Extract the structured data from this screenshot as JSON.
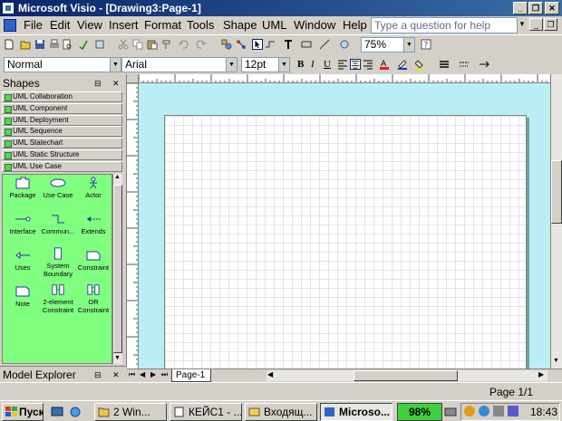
{
  "titlebar": {
    "title": "Microsoft Visio - [Drawing3:Page-1]",
    "minimize": "_",
    "restore": "❐",
    "close": "✕"
  },
  "menubar": {
    "items": [
      "File",
      "Edit",
      "View",
      "Insert",
      "Format",
      "Tools",
      "Shape",
      "UML",
      "Window",
      "Help"
    ],
    "ask_placeholder": "Type a question for help",
    "doc_min": "_",
    "doc_restore": "❐",
    "doc_close": "✕"
  },
  "toolbar": {
    "zoom": "75%"
  },
  "formatting": {
    "style": "Normal",
    "font": "Arial",
    "size": "12pt",
    "bold": "B",
    "italic": "I",
    "underline": "U"
  },
  "shapes_panel": {
    "title": "Shapes",
    "stencils": [
      "UML Collaboration",
      "UML Component",
      "UML Deployment",
      "UML Sequence",
      "UML Statechart",
      "UML Static Structure",
      "UML Use Case"
    ],
    "masters": [
      {
        "label": "Package",
        "icon": "folder-icon"
      },
      {
        "label": "Use Case",
        "icon": "ellipse-icon"
      },
      {
        "label": "Actor",
        "icon": "stick-figure-icon"
      },
      {
        "label": "Interface",
        "icon": "lollipop-icon"
      },
      {
        "label": "Commun...",
        "icon": "step-line-icon"
      },
      {
        "label": "Extends",
        "icon": "dashed-arrow-icon"
      },
      {
        "label": "Uses",
        "icon": "open-arrow-icon"
      },
      {
        "label": "System Boundary",
        "icon": "rectangle-icon"
      },
      {
        "label": "Constraint",
        "icon": "note-shape-icon"
      },
      {
        "label": "Note",
        "icon": "note-icon"
      },
      {
        "label": "2-element Constraint",
        "icon": "two-element-icon"
      },
      {
        "label": "OR Constraint",
        "icon": "or-constraint-icon"
      }
    ]
  },
  "model_explorer": {
    "title": "Model Explorer"
  },
  "tabs": {
    "page_tab": "Page-1"
  },
  "status": {
    "page": "Page 1/1"
  },
  "taskbar": {
    "start": "Пуск",
    "buttons": [
      "2 Win...",
      "КЕЙС1 - ...",
      "Входящ...",
      "Microso..."
    ],
    "battery": "98%",
    "clock": "18:43"
  },
  "colors": {
    "title_start": "#0a246a",
    "title_end": "#3a6ea5",
    "canvas_bg": "#b9eef2",
    "stencil_bg": "#80ff80"
  }
}
